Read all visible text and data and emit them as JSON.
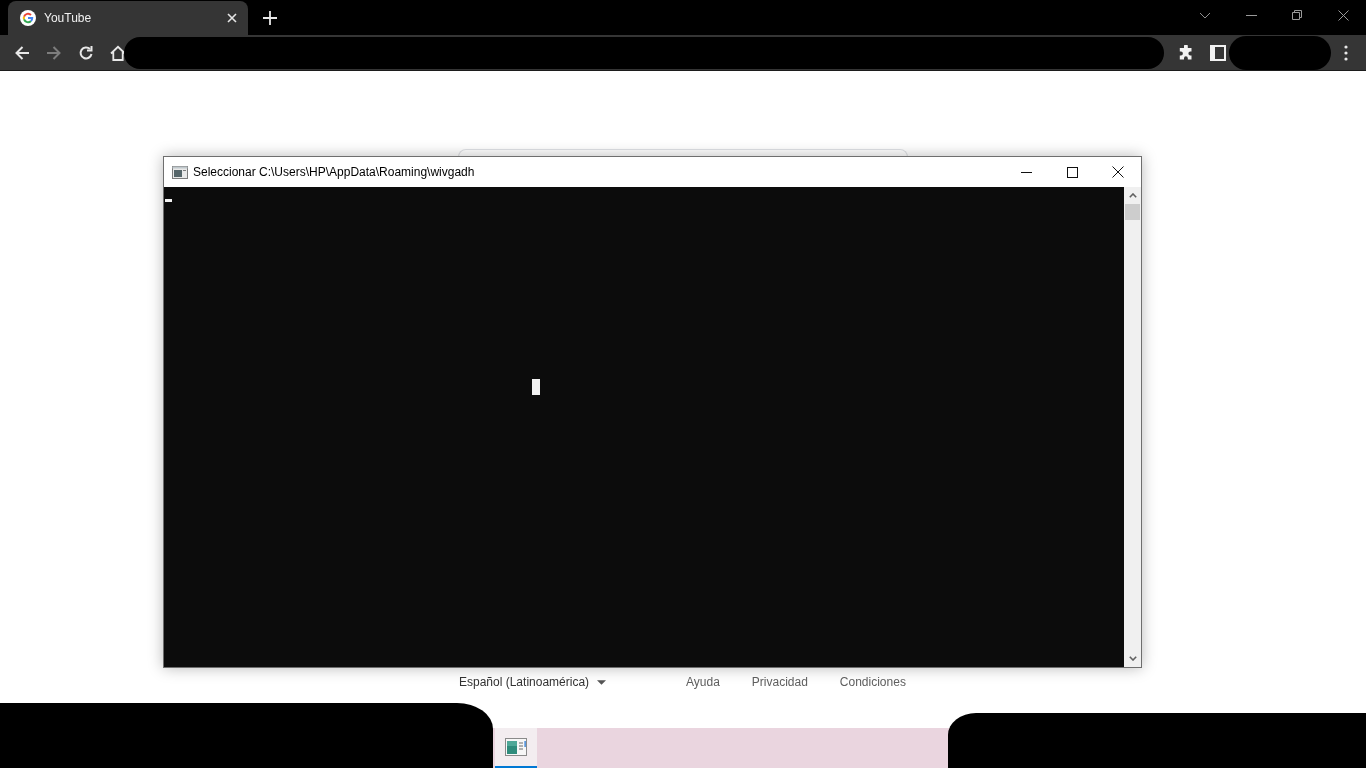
{
  "browser": {
    "tabs": [
      {
        "title": "YouTube",
        "selected": true
      }
    ],
    "toolbar": {
      "buttons": [
        {
          "kind": "back",
          "disabled": false
        },
        {
          "kind": "forward",
          "disabled": true
        },
        {
          "kind": "reload",
          "disabled": false
        },
        {
          "kind": "home",
          "disabled": false
        }
      ]
    }
  },
  "console_window": {
    "title": "Seleccionar C:\\Users\\HP\\AppData\\Roaming\\wivgadh"
  },
  "footer": {
    "language": "Español (Latinoamérica)",
    "links": [
      "Ayuda",
      "Privacidad",
      "Condiciones"
    ]
  },
  "taskbar": {
    "apps": [
      {
        "kind": "console",
        "selected": true
      }
    ]
  }
}
